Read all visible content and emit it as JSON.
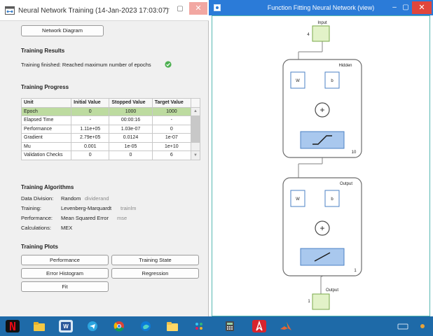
{
  "left_window": {
    "title": "Neural Network Training (14-Jan-2023 17:03:07)",
    "controls": {
      "minimize": "–",
      "maximize": "▢",
      "close": "✕"
    },
    "network_diagram_button": "Network Diagram",
    "training_results": {
      "heading": "Training Results",
      "status": "Training finished: Reached maximum number of epochs"
    },
    "training_progress": {
      "heading": "Training Progress",
      "columns": [
        "Unit",
        "Initial Value",
        "Stopped Value",
        "Target Value"
      ],
      "rows": [
        {
          "unit": "Epoch",
          "initial": "0",
          "stopped": "1000",
          "target": "1000"
        },
        {
          "unit": "Elapsed Time",
          "initial": "-",
          "stopped": "00:00:16",
          "target": "-"
        },
        {
          "unit": "Performance",
          "initial": "1.11e+05",
          "stopped": "1.03e-07",
          "target": "0"
        },
        {
          "unit": "Gradient",
          "initial": "2.79e+05",
          "stopped": "0.0124",
          "target": "1e-07"
        },
        {
          "unit": "Mu",
          "initial": "0.001",
          "stopped": "1e-05",
          "target": "1e+10"
        },
        {
          "unit": "Validation Checks",
          "initial": "0",
          "stopped": "0",
          "target": "6"
        }
      ]
    },
    "training_algorithms": {
      "heading": "Training Algorithms",
      "items": [
        {
          "label": "Data Division:",
          "value": "Random",
          "fn": "dividerand"
        },
        {
          "label": "Training:",
          "value": "Levenberg-Marquardt",
          "fn": "trainlm"
        },
        {
          "label": "Performance:",
          "value": "Mean Squared Error",
          "fn": "mse"
        },
        {
          "label": "Calculations:",
          "value": "MEX",
          "fn": ""
        }
      ]
    },
    "training_plots": {
      "heading": "Training Plots",
      "buttons": [
        "Performance",
        "Training State",
        "Error Histogram",
        "Regression",
        "Fit"
      ]
    }
  },
  "right_window": {
    "title": "Function Fitting Neural Network (view)",
    "input_label": "Input",
    "input_size": "4",
    "hidden_label": "Hidden",
    "hidden_size": "10",
    "output_layer_label": "Output",
    "output_layer_size": "1",
    "output_label": "Output",
    "output_size": "1",
    "weight_label": "W",
    "bias_label": "b",
    "sum_symbol": "+"
  },
  "colors": {
    "titlebar_right": "#2b7bd8",
    "close_red": "#e0463c",
    "epoch_highlight": "#bddba0",
    "node_green": "#e2f2c8",
    "block_blue": "#a9c8ee",
    "taskbar": "#1e6aa8"
  },
  "taskbar_icons": [
    "netflix-icon",
    "file-explorer-icon",
    "word-icon",
    "telegram-icon",
    "chrome-icon",
    "edge-icon",
    "folder-icon",
    "slack-icon",
    "calculator-icon",
    "acrobat-icon",
    "matlab-icon"
  ]
}
